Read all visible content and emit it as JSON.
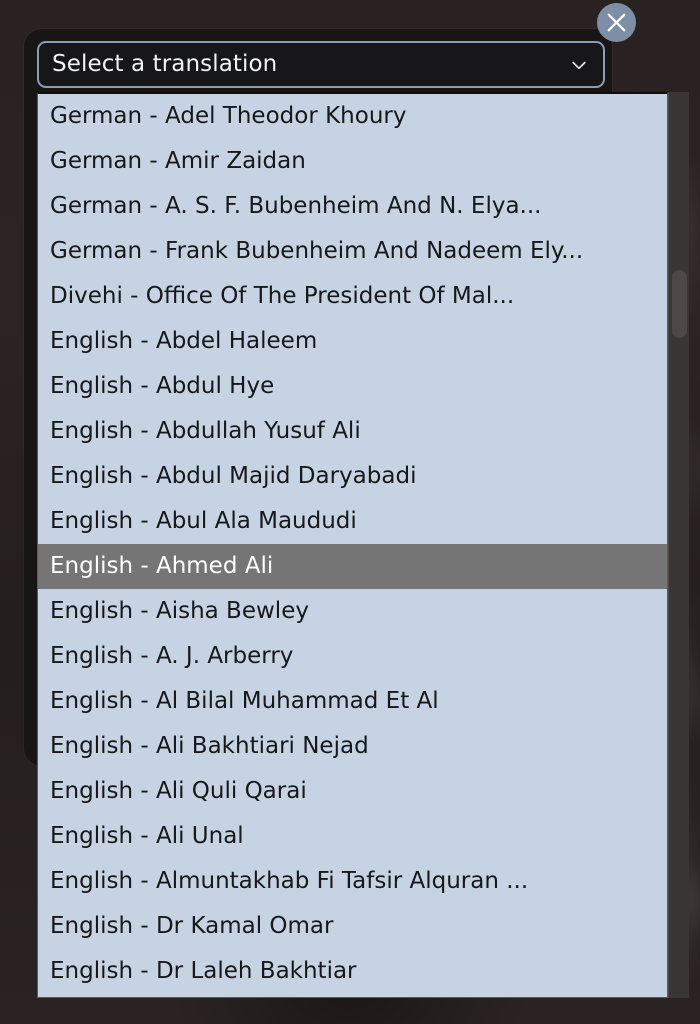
{
  "modal": {
    "close_label": "Close",
    "close_icon": "close-x-icon"
  },
  "select": {
    "placeholder": "Select a translation",
    "value": "Select a translation",
    "expanded": true,
    "chevron_icon": "chevron-down-icon",
    "selected_option": "English - Ahmed Ali",
    "selected_index": 10,
    "options": [
      "German - Adel Theodor Khoury",
      "German - Amir Zaidan",
      "German - A. S. F. Bubenheim And N. Elya...",
      "German - Frank Bubenheim And Nadeem Ely...",
      "Divehi - Office Of The President Of Mal...",
      "English - Abdel Haleem",
      "English - Abdul Hye",
      "English - Abdullah Yusuf Ali",
      "English - Abdul Majid Daryabadi",
      "English - Abul Ala Maududi",
      "English - Ahmed Ali",
      "English - Aisha Bewley",
      "English - A. J. Arberry",
      "English - Al Bilal Muhammad Et Al",
      "English - Ali Bakhtiari Nejad",
      "English - Ali Quli Qarai",
      "English - Ali Unal",
      "English - Almuntakhab Fi Tafsir Alquran ...",
      "English - Dr Kamal Omar",
      "English - Dr Laleh Bakhtiar"
    ]
  },
  "colors": {
    "list_background": "#c7d3e2",
    "list_text": "#15181c",
    "highlight_background": "#757575",
    "highlight_text": "#ffffff",
    "select_border": "#8c9cb4",
    "select_background": "#17171a",
    "select_text": "#f2f3f5",
    "modal_background": "#181515",
    "page_background": "#2b2322",
    "close_button_background": "#7e8ea6",
    "scrollbar_track": "#383534",
    "scrollbar_thumb": "#4e4846"
  }
}
